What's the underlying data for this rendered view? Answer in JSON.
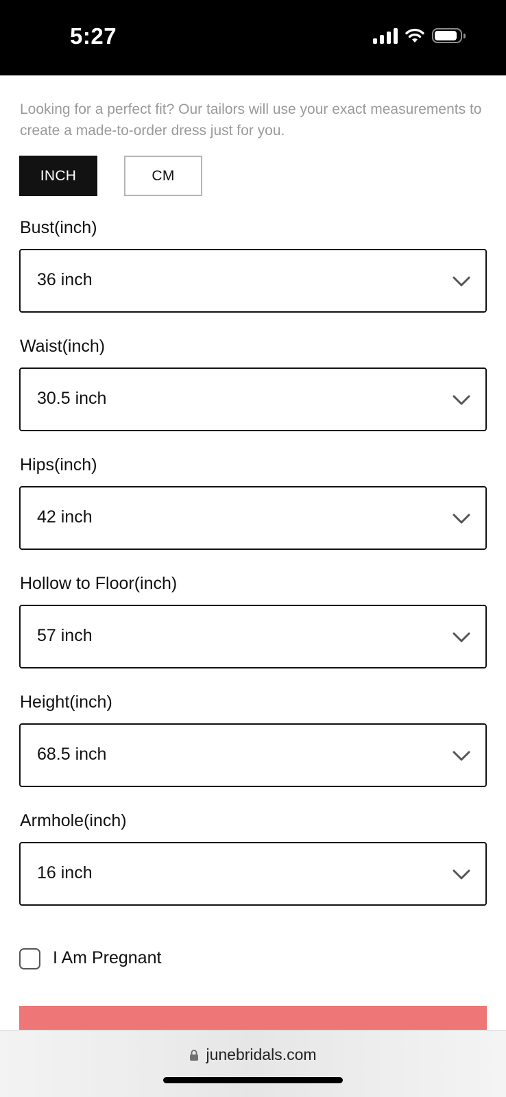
{
  "status_bar": {
    "time": "5:27",
    "signal_icon": "cellular-signal-icon",
    "wifi_icon": "wifi-icon",
    "battery_icon": "battery-icon",
    "battery_level": 0.9
  },
  "intro_text": "Looking for a perfect fit? Our tailors will use your exact measurements to create a made-to-order dress just for you.",
  "units": {
    "inch_label": "INCH",
    "cm_label": "CM",
    "selected": "INCH"
  },
  "fields": [
    {
      "label": "Bust(inch)",
      "value": "36 inch"
    },
    {
      "label": "Waist(inch)",
      "value": "30.5 inch"
    },
    {
      "label": "Hips(inch)",
      "value": "42 inch"
    },
    {
      "label": "Hollow to Floor(inch)",
      "value": "57 inch"
    },
    {
      "label": "Height(inch)",
      "value": "68.5 inch"
    },
    {
      "label": "Armhole(inch)",
      "value": "16 inch"
    }
  ],
  "pregnant": {
    "label": "I Am Pregnant",
    "checked": false
  },
  "submit_color": "#ef7676",
  "browser": {
    "url": "junebridals.com",
    "lock_icon": "lock-icon"
  }
}
